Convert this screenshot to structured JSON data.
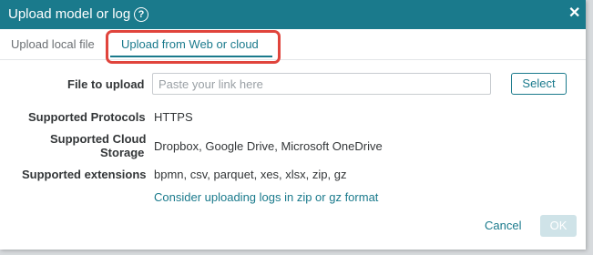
{
  "dialog": {
    "title": "Upload model or log",
    "help_glyph": "?",
    "close_glyph": "✕"
  },
  "tabs": [
    {
      "label": "Upload local file",
      "active": false
    },
    {
      "label": "Upload from Web or cloud",
      "active": true
    }
  ],
  "form": {
    "file_label": "File to upload",
    "url_placeholder": "Paste your link here",
    "url_value": "",
    "select_label": "Select",
    "protocols_label": "Supported Protocols",
    "protocols_value": "HTTPS",
    "cloud_label_line1": "Supported Cloud",
    "cloud_label_line2": "Storage",
    "cloud_value": "Dropbox, Google Drive, Microsoft OneDrive",
    "extensions_label": "Supported extensions",
    "extensions_value": "bpmn, csv, parquet, xes, xlsx, zip, gz",
    "hint_link": "Consider uploading logs in zip or gz format"
  },
  "footer": {
    "cancel_label": "Cancel",
    "ok_label": "OK"
  },
  "colors": {
    "accent": "#1a7a8c",
    "highlight": "#e0443c",
    "ok_disabled": "#cfe3e8"
  },
  "icons": [
    "help-icon",
    "close-icon"
  ]
}
